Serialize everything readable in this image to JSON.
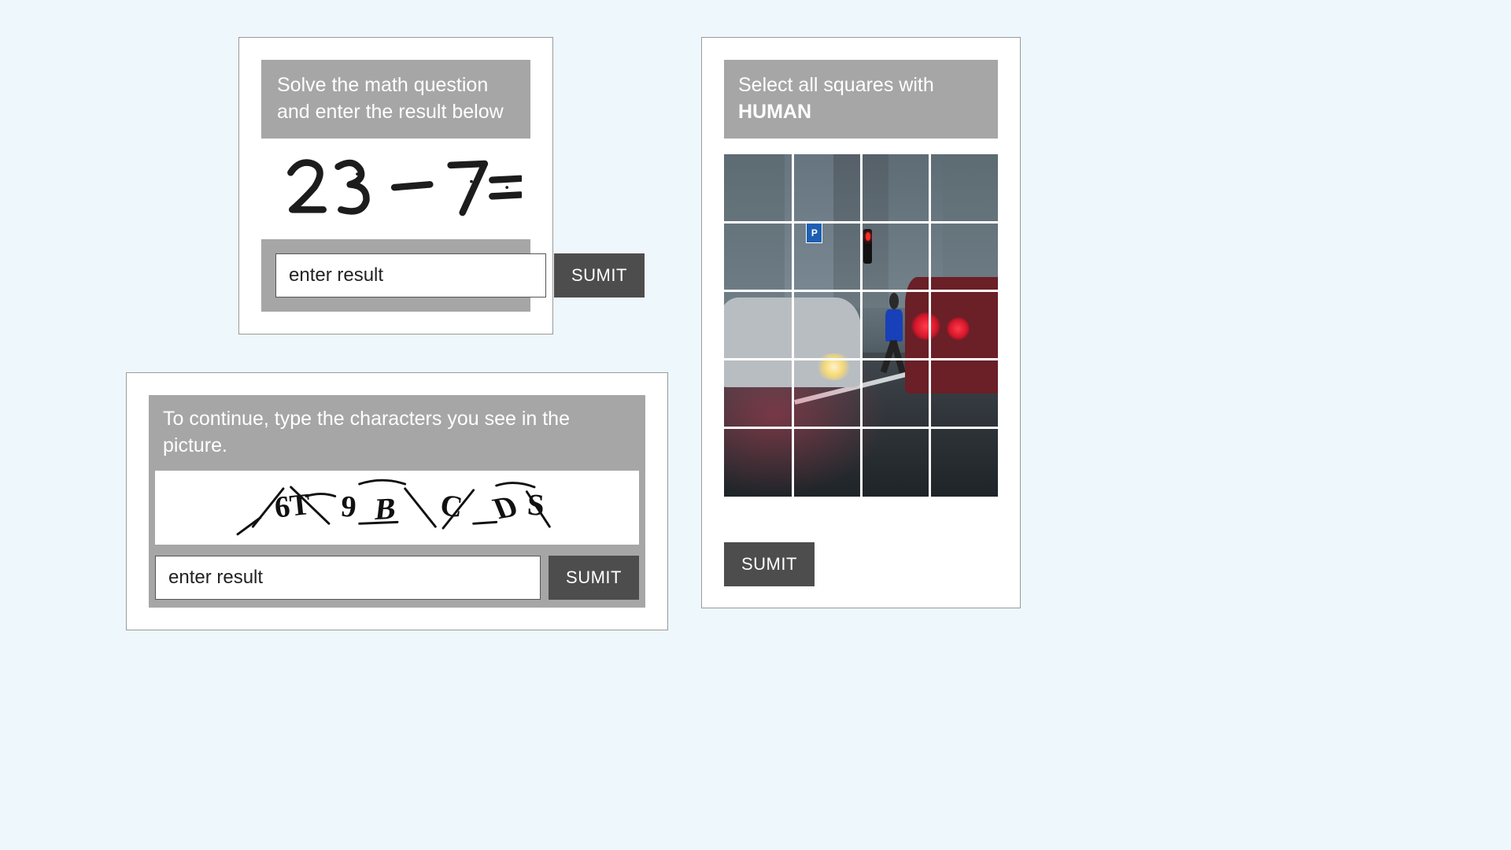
{
  "math_captcha": {
    "instruction": "Solve the math question and enter the result below",
    "expression": "23 − 7 =",
    "placeholder": "enter result",
    "submit_label": "SUMIT"
  },
  "text_captcha": {
    "instruction": "To continue, type the characters you see in the picture.",
    "characters": "6T 9 B C D S",
    "placeholder": "enter result",
    "submit_label": "SUMIT"
  },
  "image_captcha": {
    "instruction_prefix": "Select all squares with",
    "target_word": "HUMAN",
    "grid_rows": 5,
    "grid_cols": 4,
    "submit_label": "SUMIT"
  }
}
